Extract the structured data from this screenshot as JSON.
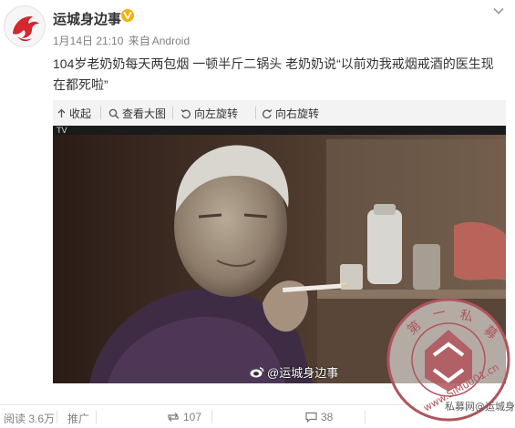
{
  "post": {
    "username": "运城身边事",
    "date": "1月14日 21:10",
    "source_prefix": "来自",
    "source": "Android",
    "text": "104岁老奶奶每天两包烟  一顿半斤二锅头  老奶奶说“以前劝我戒烟戒酒的医生现在都死啦”"
  },
  "image_toolbar": {
    "collapse": "收起",
    "view_large": "查看大图",
    "rotate_left": "向左旋转",
    "rotate_right": "向右旋转"
  },
  "image": {
    "watermark": "@运城身边事",
    "caption_top": "TV"
  },
  "footer": {
    "reads": "阅读 3.6万",
    "promote": "推广",
    "reposts": "107",
    "comments": "38",
    "likes": ""
  },
  "seal": {
    "chars": [
      "第",
      "一",
      "私",
      "募"
    ],
    "url": "www.SiMu001.cn",
    "footer_wm": "私募网@运城身边事"
  },
  "colors": {
    "accent": "#eb7350",
    "meta": "#808080",
    "seal": "#b0545b"
  }
}
